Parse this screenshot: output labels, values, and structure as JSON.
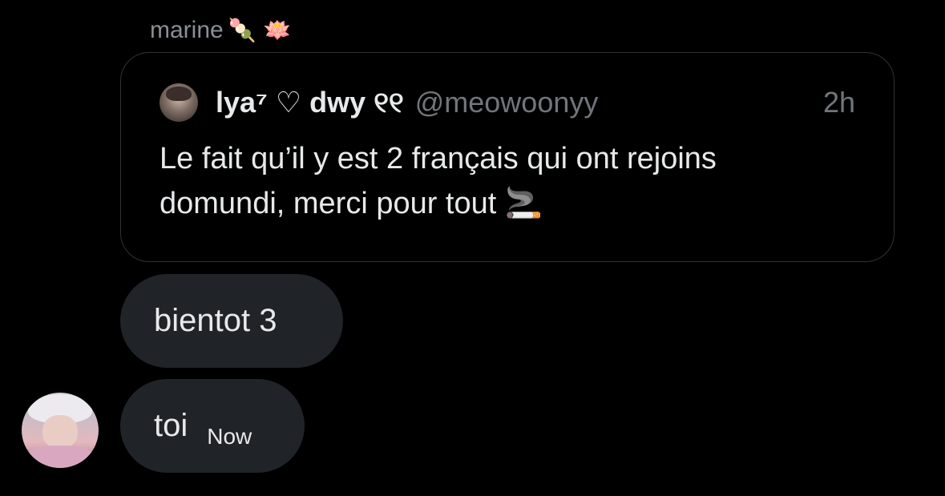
{
  "header": {
    "sender_name": "marine",
    "sender_emojis": "🍡 🪷"
  },
  "quote": {
    "display_name": "lya⁷ ♡ dwy ୧୧",
    "handle": "@meowoonyy",
    "time": "2h",
    "text": "Le fait qu’il y est 2 français qui ont rejoins domundi, merci pour tout 🚬"
  },
  "messages": [
    {
      "text": "bientot 3"
    },
    {
      "text": "toi",
      "time": "Now"
    }
  ],
  "colors": {
    "background": "#000000",
    "bubble": "#202327",
    "card_border": "#2f3336",
    "muted_text": "#71767b",
    "primary_text": "#e7e9ea"
  }
}
